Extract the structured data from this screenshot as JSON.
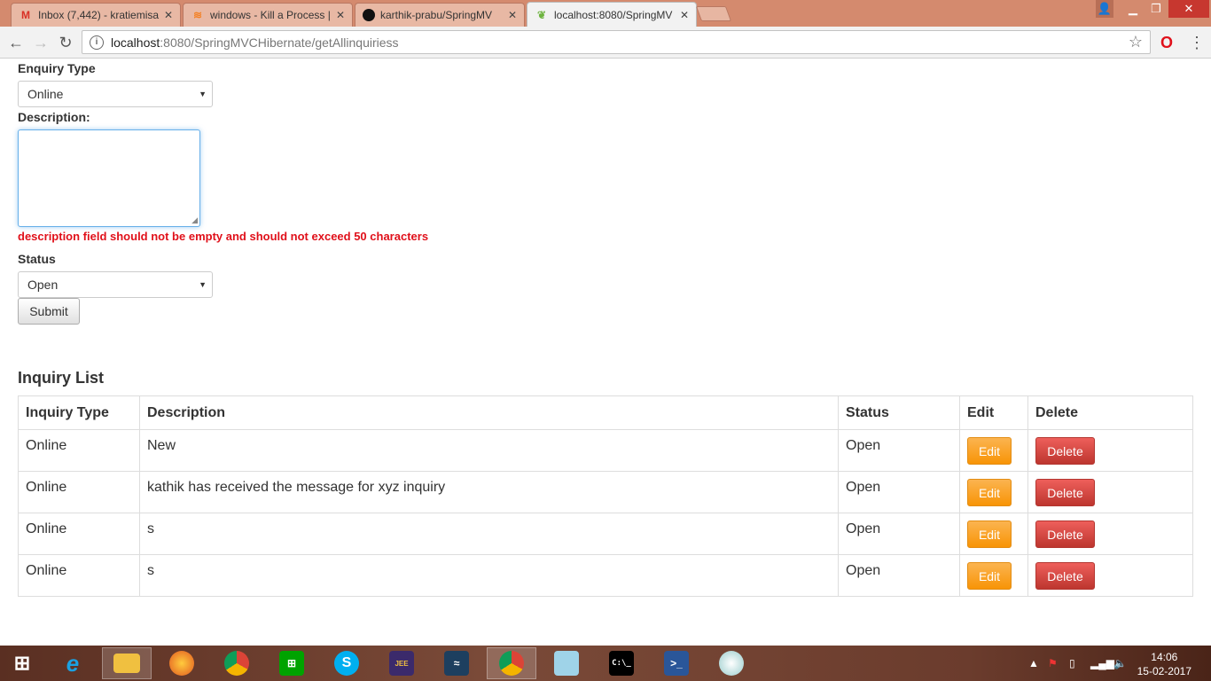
{
  "browser": {
    "tabs": [
      {
        "title": "Inbox (7,442) - kratiemisa",
        "icon": "gmail-icon",
        "active": false
      },
      {
        "title": "windows - Kill a Process |",
        "icon": "stackoverflow-icon",
        "active": false
      },
      {
        "title": "karthik-prabu/SpringMV",
        "icon": "github-icon",
        "active": false
      },
      {
        "title": "localhost:8080/SpringMV",
        "icon": "spring-leaf-icon",
        "active": true
      }
    ],
    "url_host": "localhost",
    "url_path": ":8080/SpringMVCHibernate/getAllinquiriess"
  },
  "form": {
    "enquiry_type_label": "Enquiry Type",
    "enquiry_type_value": "Online",
    "description_label": "Description:",
    "description_value": "",
    "error_message": "description field should not be empty and should not exceed 50 characters",
    "status_label": "Status",
    "status_value": "Open",
    "submit_label": "Submit"
  },
  "inquiry_list": {
    "title": "Inquiry List",
    "columns": [
      "Inquiry Type",
      "Description",
      "Status",
      "Edit",
      "Delete"
    ],
    "edit_label": "Edit",
    "delete_label": "Delete",
    "rows": [
      {
        "type": "Online",
        "description": "New",
        "status": "Open"
      },
      {
        "type": "Online",
        "description": "kathik has received the message for xyz inquiry",
        "status": "Open"
      },
      {
        "type": "Online",
        "description": "s",
        "status": "Open"
      },
      {
        "type": "Online",
        "description": "s",
        "status": "Open"
      }
    ]
  },
  "taskbar": {
    "time": "14:06",
    "date": "15-02-2017",
    "apps": [
      "windows-start-icon",
      "internet-explorer-icon",
      "file-explorer-icon",
      "firefox-icon",
      "chrome-icon",
      "windows-store-icon",
      "skype-icon",
      "java-ee-ide-icon",
      "mysql-workbench-icon",
      "chrome-icon",
      "notepad-icon",
      "cmd-icon",
      "powershell-icon",
      "paint-icon"
    ]
  },
  "colors": {
    "error": "#e0101a",
    "edit_button": "#f89406",
    "delete_button": "#d9534f",
    "focus_border": "#66afe9"
  }
}
